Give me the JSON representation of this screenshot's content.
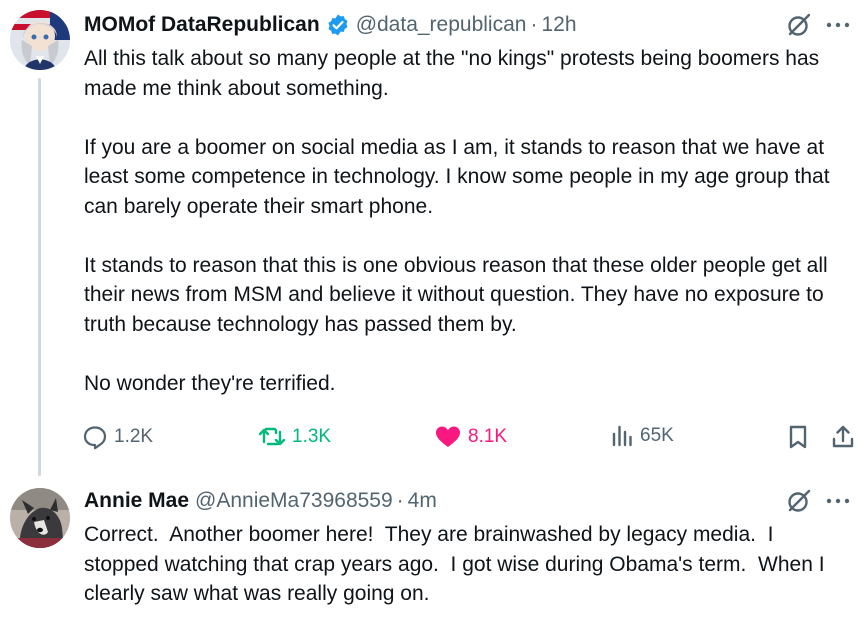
{
  "main_tweet": {
    "display_name": "MOMof DataRepublican",
    "handle": "@data_republican",
    "separator": "·",
    "time": "12h",
    "paragraphs": [
      "All this talk about so many people at the \"no kings\" protests being boomers has made me think about something.",
      "If you are a boomer on social media as I am, it stands to reason that we have at least some competence in technology. I know some people in my age group that can barely operate their smart phone.",
      "It stands to reason that this is one obvious reason that these older people get all their news from MSM and believe it without question. They have no exposure to truth because technology has passed them by.",
      "No wonder they're terrified."
    ],
    "stats": {
      "replies": "1.2K",
      "retweets": "1.3K",
      "likes": "8.1K",
      "views": "65K"
    },
    "icons": {
      "verified": "verified-badge-icon",
      "grok": "grok-icon",
      "more": "more-icon",
      "reply": "reply-icon",
      "retweet": "retweet-icon",
      "like": "heart-icon",
      "views": "views-icon",
      "bookmark": "bookmark-icon",
      "share": "share-icon"
    }
  },
  "reply_tweet": {
    "display_name": "Annie Mae",
    "handle": "@AnnieMa73968559",
    "separator": "·",
    "time": "4m",
    "text": "Correct.  Another boomer here!  They are brainwashed by legacy media.  I stopped watching that crap years ago.  I got wise during Obama's term.  When I clearly saw what was really going on."
  },
  "colors": {
    "text": "#0f1419",
    "secondary": "#536471",
    "verified_blue": "#1d9bf0",
    "retweet_green": "#00ba7c",
    "like_pink": "#f91880",
    "thread_line": "#cfd9de"
  }
}
